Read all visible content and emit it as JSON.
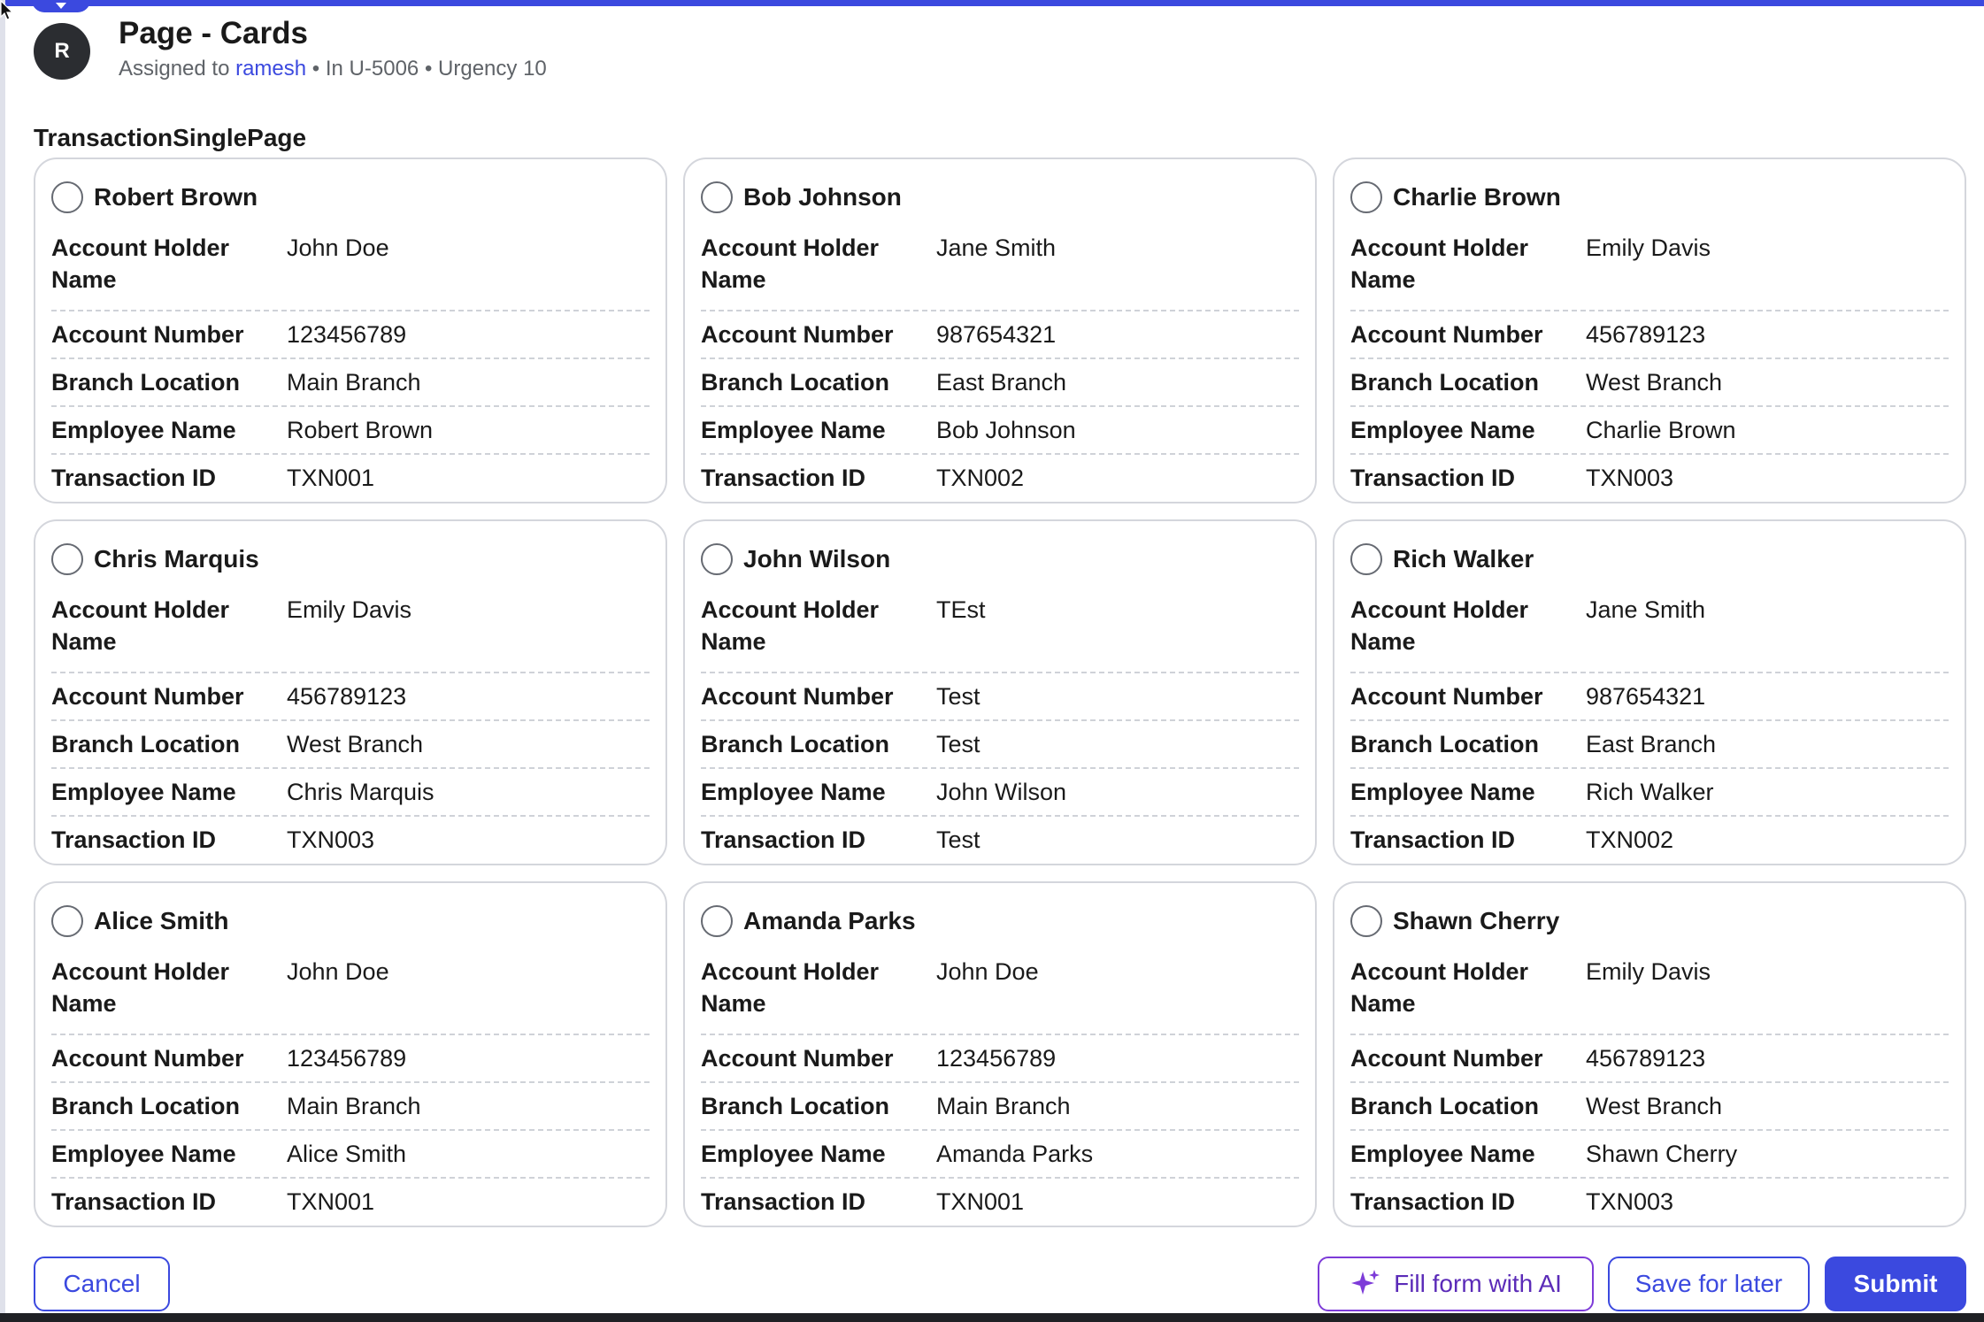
{
  "header": {
    "avatar_initial": "R",
    "title": "Page - Cards",
    "assigned_prefix": "Assigned to",
    "assignee": "ramesh",
    "case_id": "In U-5006",
    "urgency": "Urgency 10",
    "separator": "•"
  },
  "section_label": "TransactionSinglePage",
  "field_labels": {
    "account_holder": "Account Holder Name",
    "account_number": "Account Number",
    "branch": "Branch Location",
    "employee": "Employee Name",
    "transaction": "Transaction ID"
  },
  "cards": [
    {
      "title": "Robert Brown",
      "account_holder": "John Doe",
      "account_number": "123456789",
      "branch": "Main Branch",
      "employee": "Robert Brown",
      "transaction": "TXN001"
    },
    {
      "title": "Bob Johnson",
      "account_holder": "Jane Smith",
      "account_number": "987654321",
      "branch": "East Branch",
      "employee": "Bob Johnson",
      "transaction": "TXN002"
    },
    {
      "title": "Charlie Brown",
      "account_holder": "Emily Davis",
      "account_number": "456789123",
      "branch": "West Branch",
      "employee": "Charlie Brown",
      "transaction": "TXN003"
    },
    {
      "title": "Chris Marquis",
      "account_holder": "Emily Davis",
      "account_number": "456789123",
      "branch": "West Branch",
      "employee": "Chris Marquis",
      "transaction": "TXN003"
    },
    {
      "title": "John Wilson",
      "account_holder": "TEst",
      "account_number": "Test",
      "branch": "Test",
      "employee": "John Wilson",
      "transaction": "Test"
    },
    {
      "title": "Rich Walker",
      "account_holder": "Jane Smith",
      "account_number": "987654321",
      "branch": "East Branch",
      "employee": "Rich Walker",
      "transaction": "TXN002"
    },
    {
      "title": "Alice Smith",
      "account_holder": "John Doe",
      "account_number": "123456789",
      "branch": "Main Branch",
      "employee": "Alice Smith",
      "transaction": "TXN001"
    },
    {
      "title": "Amanda Parks",
      "account_holder": "John Doe",
      "account_number": "123456789",
      "branch": "Main Branch",
      "employee": "Amanda Parks",
      "transaction": "TXN001"
    },
    {
      "title": "Shawn Cherry",
      "account_holder": "Emily Davis",
      "account_number": "456789123",
      "branch": "West Branch",
      "employee": "Shawn Cherry",
      "transaction": "TXN003"
    }
  ],
  "footer": {
    "cancel_label": "Cancel",
    "ai_label": "Fill form with AI",
    "save_label": "Save for later",
    "submit_label": "Submit"
  },
  "colors": {
    "accent": "#3b49df",
    "ai_accent": "#7d3bd8",
    "avatar_bg": "#2b2d31"
  },
  "icons": {
    "ai": "sparkle-icon",
    "radio": "radio-unselected-icon",
    "top_tab": "chevron-down-icon",
    "cursor": "mouse-pointer-icon"
  }
}
